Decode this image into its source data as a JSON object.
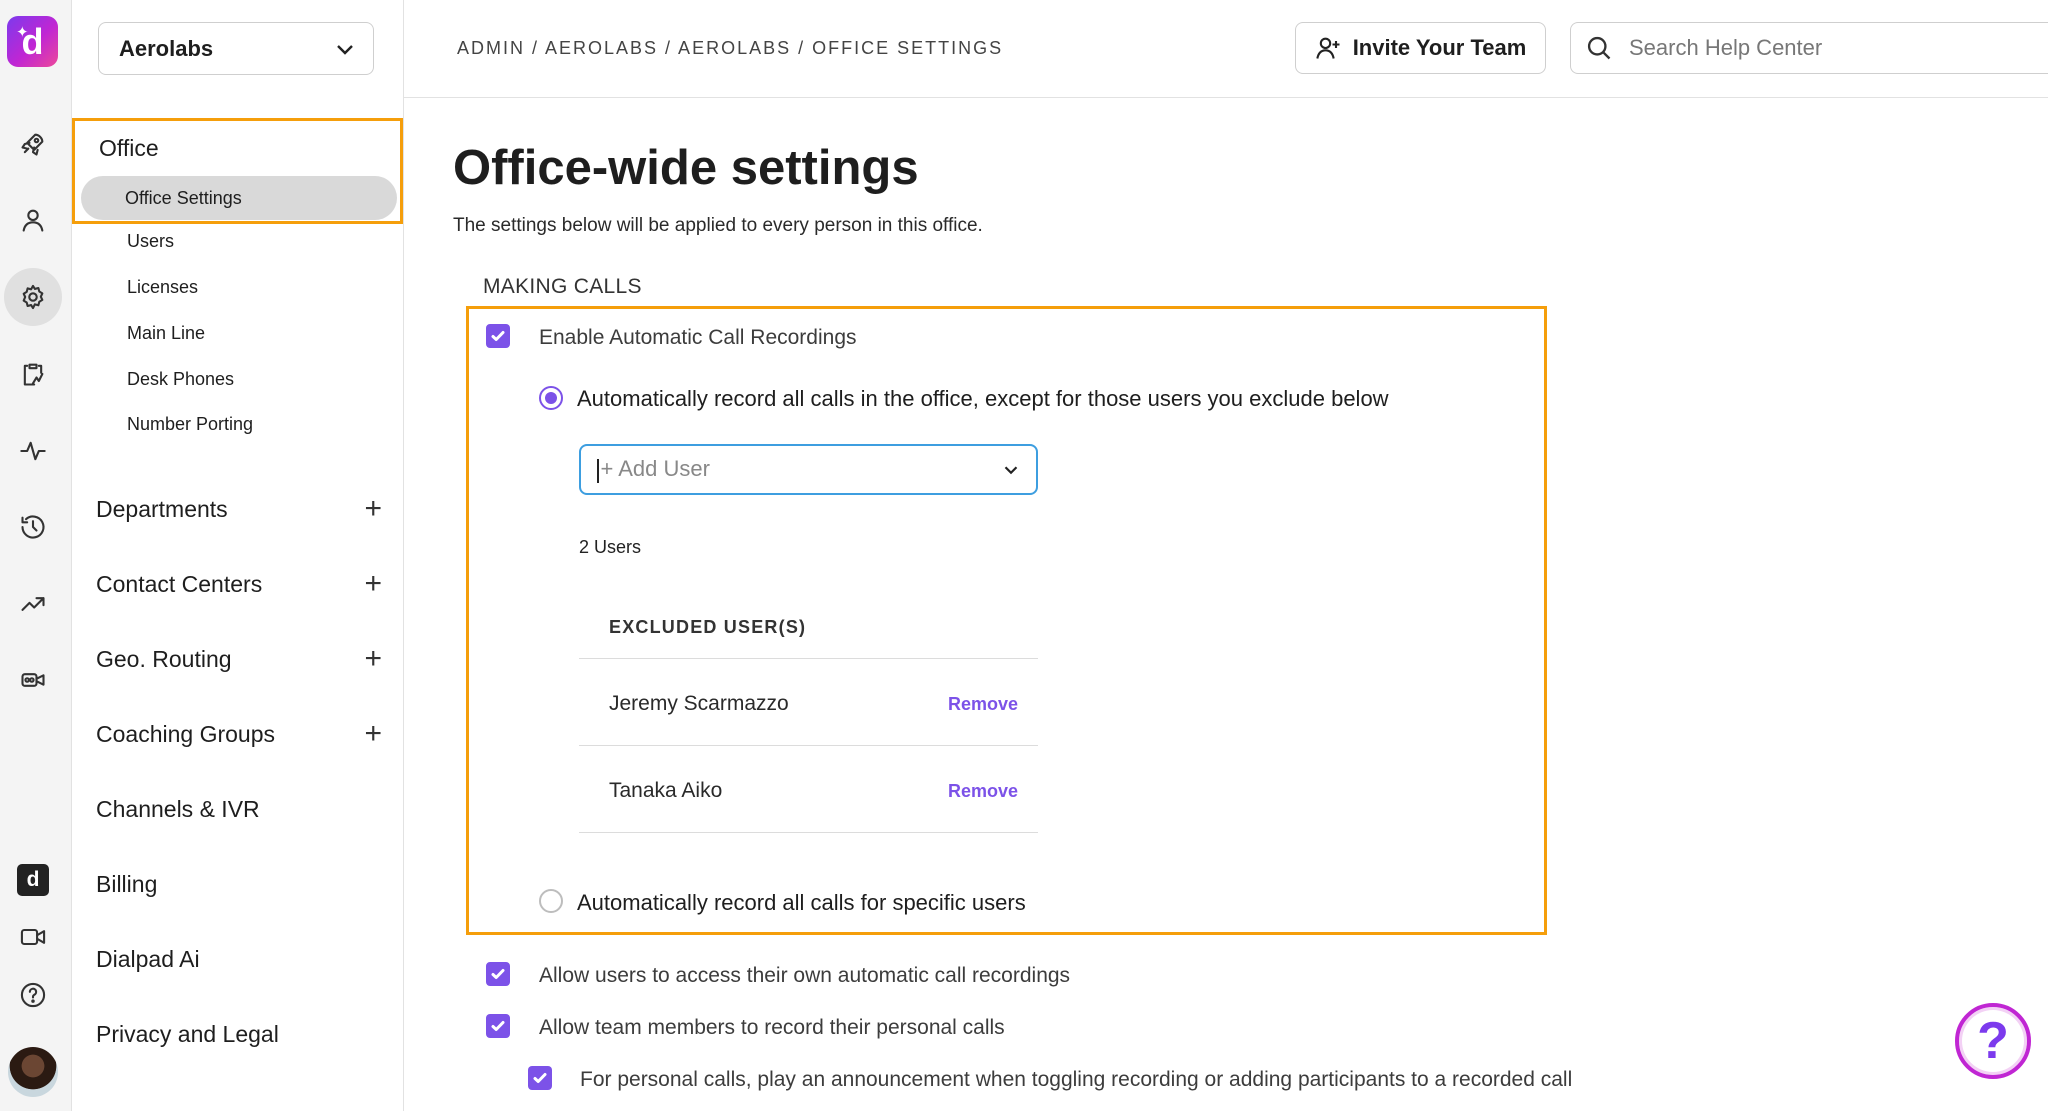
{
  "rail": {
    "logo_letter": "d",
    "app_badge_letter": "d"
  },
  "sidebar": {
    "org_name": "Aerolabs",
    "office": {
      "label": "Office",
      "items": [
        "Office Settings",
        "Users",
        "Licenses",
        "Main Line",
        "Desk Phones",
        "Number Porting"
      ]
    },
    "sections": [
      {
        "label": "Departments",
        "expandable": true
      },
      {
        "label": "Contact Centers",
        "expandable": true
      },
      {
        "label": "Geo. Routing",
        "expandable": true
      },
      {
        "label": "Coaching Groups",
        "expandable": true
      },
      {
        "label": "Channels & IVR",
        "expandable": false
      },
      {
        "label": "Billing",
        "expandable": false
      },
      {
        "label": "Dialpad Ai",
        "expandable": false
      },
      {
        "label": "Privacy and Legal",
        "expandable": false
      }
    ],
    "plus_glyph": "+"
  },
  "header": {
    "breadcrumb": "ADMIN / AEROLABS / AEROLABS / OFFICE SETTINGS",
    "invite_label": "Invite Your Team",
    "search_placeholder": "Search Help Center"
  },
  "main": {
    "title": "Office-wide settings",
    "description": "The settings below will be applied to every person in this office.",
    "section_label": "MAKING CALLS",
    "enable_recordings": {
      "label": "Enable Automatic Call Recordings",
      "checked": true
    },
    "radio_all": {
      "label": "Automatically record all calls in the office, except for those users you exclude below",
      "selected": true
    },
    "add_user_placeholder": "+ Add User",
    "user_count": "2 Users",
    "excluded_header": "EXCLUDED USER(S)",
    "excluded_users": [
      {
        "name": "Jeremy Scarmazzo",
        "action": "Remove"
      },
      {
        "name": "Tanaka Aiko",
        "action": "Remove"
      }
    ],
    "radio_specific": {
      "label": "Automatically record all calls for specific users",
      "selected": false
    },
    "allow_own_recordings": {
      "label": "Allow users to access their own automatic call recordings",
      "checked": true
    },
    "allow_personal_record": {
      "label": "Allow team members to record their personal calls",
      "checked": true
    },
    "announcement": {
      "label": "For personal calls, play an announcement when toggling recording or adding participants to a recorded call",
      "checked": true
    }
  },
  "help_button": {
    "glyph": "?"
  },
  "colors": {
    "accent": "#7c52e8",
    "highlight": "#f59e0b",
    "focus": "#3d9ee0"
  }
}
